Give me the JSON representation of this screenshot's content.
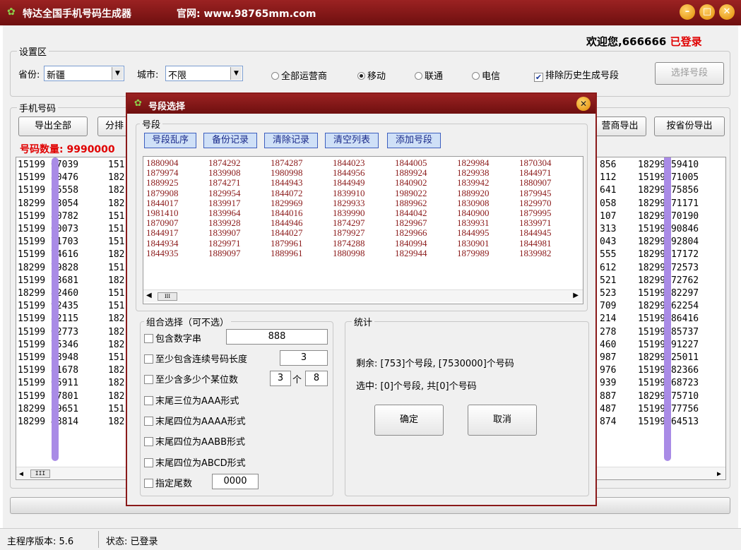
{
  "window": {
    "title": "特达全国手机号码生成器",
    "site": "官网: www.98765mm.com",
    "buttons": [
      "minimize",
      "maximize",
      "close"
    ]
  },
  "welcome": {
    "text": "欢迎您,666666",
    "status": "已登录"
  },
  "settings": {
    "legend": "设置区",
    "province_label": "省份:",
    "province_value": "新疆",
    "city_label": "城市:",
    "city_value": "不限",
    "carriers": [
      {
        "label": "全部运营商",
        "selected": false
      },
      {
        "label": "移动",
        "selected": true
      },
      {
        "label": "联通",
        "selected": false
      },
      {
        "label": "电信",
        "selected": false
      }
    ],
    "exclude_history_label": "排除历史生成号段",
    "exclude_history_checked": true,
    "select_segment_button": "选择号段"
  },
  "phones": {
    "legend": "手机号码",
    "export_all_button": "导出全部",
    "split_button_partial": "分排",
    "carrier_export_partial": "营商导出",
    "province_export_button": "按省份导出",
    "count_label": "号码数量: 9990000",
    "col1": [
      "15199 67039",
      "15199 80476",
      "15199 65558",
      "18299 73054",
      "15199 80782",
      "15199 60073",
      "15199 71703",
      "15199 74616",
      "18299 79828",
      "15199 73681",
      "18299 82460",
      "15199 92435",
      "15199 82115",
      "15199 62773",
      "15199 75346",
      "15199 88948",
      "15199 81678",
      "15199 65911",
      "15199 77801",
      "18299 89651",
      "18299 48814"
    ],
    "col2": [
      "151",
      "182",
      "182",
      "182",
      "151",
      "151",
      "151",
      "182",
      "151",
      "182",
      "151",
      "151",
      "182",
      "182",
      "182",
      "151",
      "182",
      "182",
      "182",
      "151",
      "182"
    ],
    "col_right1": [
      "856",
      "112",
      "641",
      "058",
      "107",
      "313",
      "043",
      "555",
      "612",
      "521",
      "523",
      "709",
      "214",
      "278",
      "460",
      "987",
      "976",
      "939",
      "887",
      "487",
      "874"
    ],
    "col_right2": [
      "18299 59410",
      "15199 71005",
      "18299 75856",
      "18299 71171",
      "18299 70190",
      "15199 90846",
      "18299 92804",
      "18299 17172",
      "18299 72573",
      "18299 72762",
      "15199 82297",
      "18299 62254",
      "15199 86416",
      "15199 85737",
      "15199 91227",
      "18299 25011",
      "15199 82366",
      "15199 68723",
      "18299 75710",
      "15199 77756",
      "15199 64513"
    ]
  },
  "dialog": {
    "title": "号段选择",
    "segment_legend": "号段",
    "segment_buttons": [
      "号段乱序",
      "备份记录",
      "清除记录",
      "清空列表",
      "添加号段"
    ],
    "segments": [
      [
        "1880904",
        "1879974",
        "1889925",
        "1879908",
        "1844017",
        "1981410",
        "1870907",
        "1844917",
        "1844934",
        "1844935"
      ],
      [
        "1874292",
        "1839908",
        "1874271",
        "1829954",
        "1839917",
        "1839964",
        "1839928",
        "1839907",
        "1829971",
        "1889097"
      ],
      [
        "1874287",
        "1980998",
        "1844943",
        "1844072",
        "1829969",
        "1844016",
        "1844946",
        "1844027",
        "1879961",
        "1889961"
      ],
      [
        "1844023",
        "1844956",
        "1844949",
        "1839910",
        "1829933",
        "1839990",
        "1874297",
        "1879927",
        "1874288",
        "1880998"
      ],
      [
        "1844005",
        "1889924",
        "1840902",
        "1989022",
        "1889962",
        "1844042",
        "1829967",
        "1829966",
        "1840994",
        "1829944"
      ],
      [
        "1829984",
        "1829938",
        "1839942",
        "1889920",
        "1830908",
        "1840900",
        "1839931",
        "1844995",
        "1830901",
        "1879989"
      ],
      [
        "1870304",
        "1844971",
        "1880907",
        "1879945",
        "1829970",
        "1879995",
        "1839971",
        "1844945",
        "1844981",
        "1839982"
      ]
    ],
    "combo_legend": "组合选择（可不选）",
    "options": {
      "contains_label": "包含数字串",
      "contains_value": "888",
      "consecutive_label": "至少包含连续号码长度",
      "consecutive_value": "3",
      "atleast_label": "至少含多少个某位数",
      "atleast_count": "3",
      "atleast_unit": "个",
      "atleast_digit": "8",
      "aaa_label": "末尾三位为AAA形式",
      "aaaa_label": "末尾四位为AAAA形式",
      "aabb_label": "末尾四位为AABB形式",
      "abcd_label": "末尾四位为ABCD形式",
      "tail_label": "指定尾数",
      "tail_value": "0000"
    },
    "stats_legend": "统计",
    "remaining": "剩余: [753]个号段, [7530000]个号码",
    "selected": "选中: [0]个号段, 共[0]个号码",
    "ok_button": "确定",
    "cancel_button": "取消"
  },
  "status": {
    "version": "主程序版本: 5.6",
    "state": "状态: 已登录"
  },
  "colors": {
    "title_bar": "#8b1a1a",
    "accent_red": "#e00000",
    "segment_text": "#8b1a1a"
  }
}
